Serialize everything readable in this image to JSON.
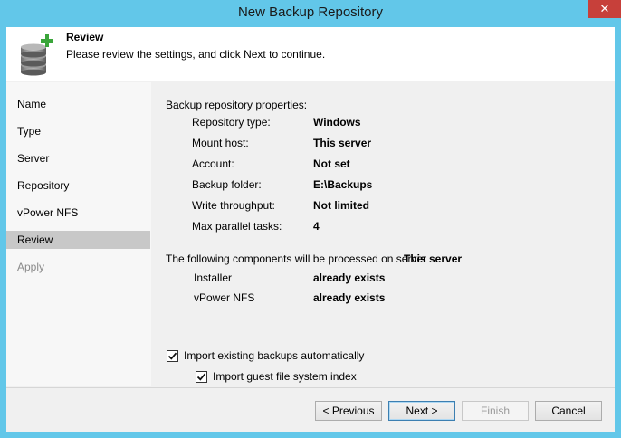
{
  "window": {
    "title": "New Backup Repository",
    "close_label": "✕"
  },
  "header": {
    "title": "Review",
    "subtitle": "Please review the settings, and click Next to continue."
  },
  "steps": [
    {
      "label": "Name"
    },
    {
      "label": "Type"
    },
    {
      "label": "Server"
    },
    {
      "label": "Repository"
    },
    {
      "label": "vPower NFS"
    },
    {
      "label": "Review"
    },
    {
      "label": "Apply"
    }
  ],
  "properties": {
    "heading": "Backup repository properties:",
    "rows": [
      {
        "label": "Repository type:",
        "value": "Windows"
      },
      {
        "label": "Mount host:",
        "value": "This server"
      },
      {
        "label": "Account:",
        "value": "Not set"
      },
      {
        "label": "Backup folder:",
        "value": "E:\\Backups"
      },
      {
        "label": "Write throughput:",
        "value": "Not limited"
      },
      {
        "label": "Max parallel tasks:",
        "value": "4"
      }
    ]
  },
  "components": {
    "heading": "The following components will be processed on server",
    "server": "This server",
    "rows": [
      {
        "label": "Installer",
        "value": "already exists"
      },
      {
        "label": "vPower NFS",
        "value": "already exists"
      }
    ]
  },
  "options": {
    "import_backups": {
      "label": "Import existing backups automatically",
      "checked": true
    },
    "import_index": {
      "label": "Import guest file system index",
      "checked": true
    }
  },
  "buttons": {
    "previous": "< Previous",
    "next": "Next >",
    "finish": "Finish",
    "cancel": "Cancel"
  }
}
